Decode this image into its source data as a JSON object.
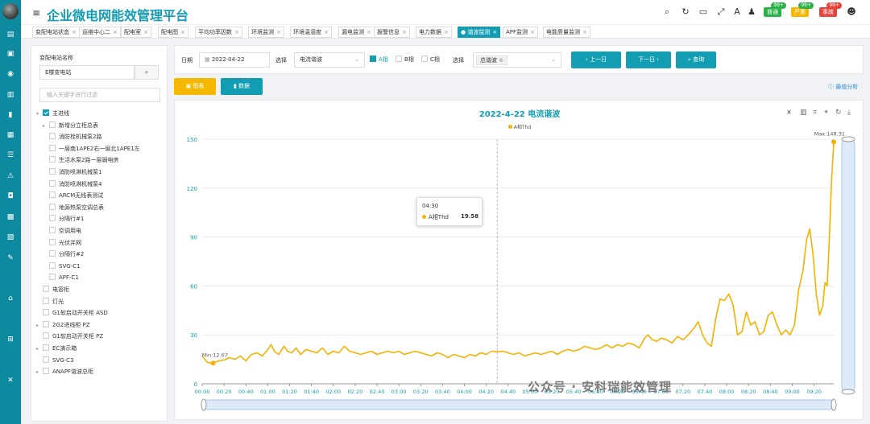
{
  "header": {
    "title": "企业微电网能效管理平台",
    "badges": [
      {
        "label": "普通",
        "count": "99+",
        "color": "#2cb24a",
        "badge_color": "#2cb24a"
      },
      {
        "label": "严重",
        "count": "99+",
        "color": "#f5b800",
        "badge_color": "#2cb24a"
      },
      {
        "label": "事故",
        "count": "99+",
        "color": "#e8463c",
        "badge_color": "#e8463c"
      }
    ]
  },
  "tabs": [
    {
      "label": "变配电站状态"
    },
    {
      "label": "运维中心二"
    },
    {
      "label": "配电室"
    },
    {
      "label": "配电图"
    },
    {
      "label": "平均功率因数"
    },
    {
      "label": "环境监测"
    },
    {
      "label": "环境温湿度"
    },
    {
      "label": "漏电监测"
    },
    {
      "label": "报警信息"
    },
    {
      "label": "电力数据"
    },
    {
      "label": "谐波监测"
    },
    {
      "label": "APF监测"
    },
    {
      "label": "电能质量监测"
    }
  ],
  "active_tab": 10,
  "left_panel": {
    "station_label": "变配电站名称",
    "station_value": "E楼变电站",
    "filter_placeholder": "输入关键字进行过滤",
    "tree": [
      {
        "label": "主进线",
        "level": 0,
        "checked": true,
        "arrow": "▾"
      },
      {
        "label": "新增分立柜总表",
        "level": 1,
        "checked": false,
        "arrow": "▸"
      },
      {
        "label": "消防栓机械泵2路",
        "level": 1,
        "checked": false,
        "arrow": ""
      },
      {
        "label": "一层南1APE2右一层北1APE1左",
        "level": 1,
        "checked": false,
        "arrow": ""
      },
      {
        "label": "生活水泵2路一层弱电房",
        "level": 1,
        "checked": false,
        "arrow": ""
      },
      {
        "label": "消防喷淋机械泵1",
        "level": 1,
        "checked": false,
        "arrow": ""
      },
      {
        "label": "消防喷淋机械泵4",
        "level": 1,
        "checked": false,
        "arrow": ""
      },
      {
        "label": "ARCM无线表测试",
        "level": 1,
        "checked": false,
        "arrow": ""
      },
      {
        "label": "地源热泵空调总表",
        "level": 1,
        "checked": false,
        "arrow": ""
      },
      {
        "label": "分隔行#1",
        "level": 1,
        "checked": false,
        "arrow": ""
      },
      {
        "label": "空调用电",
        "level": 1,
        "checked": false,
        "arrow": ""
      },
      {
        "label": "光伏并网",
        "level": 1,
        "checked": false,
        "arrow": ""
      },
      {
        "label": "分隔行#2",
        "level": 1,
        "checked": false,
        "arrow": ""
      },
      {
        "label": "SVG-C1",
        "level": 1,
        "checked": false,
        "arrow": ""
      },
      {
        "label": "APF-C1",
        "level": 1,
        "checked": false,
        "arrow": ""
      },
      {
        "label": "电容柜",
        "level": 0,
        "checked": false,
        "arrow": ""
      },
      {
        "label": "灯光",
        "level": 0,
        "checked": false,
        "arrow": ""
      },
      {
        "label": "G1软启动开关柜 ASD",
        "level": 0,
        "checked": false,
        "arrow": ""
      },
      {
        "label": "2G2进线柜 PZ",
        "level": 0,
        "checked": false,
        "arrow": "▸"
      },
      {
        "label": "G1软启动开关柜 PZ",
        "level": 0,
        "checked": false,
        "arrow": ""
      },
      {
        "label": "EC演示箱",
        "level": 0,
        "checked": false,
        "arrow": "▸"
      },
      {
        "label": "SVG-C3",
        "level": 0,
        "checked": false,
        "arrow": ""
      },
      {
        "label": "ANAPF谐波总柜",
        "level": 0,
        "checked": false,
        "arrow": "▸"
      }
    ]
  },
  "filters": {
    "date_label": "日期",
    "date_value": "2022-04-22",
    "select_label": "选择",
    "type_value": "电流谐波",
    "phase_a": "A相",
    "phase_b": "B相",
    "phase_c": "C相",
    "select_label2": "选择",
    "harmonic_chip": "总谐波",
    "prev_day": "上一日",
    "next_day": "下一日",
    "query": "查询"
  },
  "view_buttons": {
    "chart": "图表",
    "data": "数据"
  },
  "best_analysis": "最值分析",
  "chart_data": {
    "type": "line",
    "title": "2022-4-22  电流谐波",
    "series_name": "A相Thd",
    "ylim": [
      0,
      150
    ],
    "y_ticks": [
      0,
      30,
      60,
      90,
      120,
      150
    ],
    "x_ticks": [
      "00:00",
      "00:20",
      "00:40",
      "01:00",
      "01:20",
      "01:40",
      "02:00",
      "02:20",
      "02:40",
      "03:00",
      "03:20",
      "03:40",
      "04:00",
      "04:20",
      "04:40",
      "05:00",
      "05:20",
      "05:40",
      "06:00",
      "06:20",
      "06:40",
      "07:00",
      "07:20",
      "07:40",
      "08:00",
      "08:20",
      "08:40",
      "09:00",
      "09:20"
    ],
    "x_start_min": 0,
    "x_end_min": 578,
    "values": [
      [
        0,
        17
      ],
      [
        5,
        13
      ],
      [
        10,
        12.67
      ],
      [
        15,
        14
      ],
      [
        20,
        14.5
      ],
      [
        25,
        16
      ],
      [
        30,
        15
      ],
      [
        35,
        17
      ],
      [
        40,
        14
      ],
      [
        45,
        18
      ],
      [
        50,
        19
      ],
      [
        55,
        17
      ],
      [
        60,
        21
      ],
      [
        63,
        24
      ],
      [
        66,
        20
      ],
      [
        70,
        18
      ],
      [
        75,
        23
      ],
      [
        78,
        20
      ],
      [
        82,
        19
      ],
      [
        86,
        22
      ],
      [
        90,
        18
      ],
      [
        95,
        21
      ],
      [
        100,
        20
      ],
      [
        105,
        19
      ],
      [
        110,
        22
      ],
      [
        115,
        18
      ],
      [
        120,
        20
      ],
      [
        125,
        19
      ],
      [
        130,
        23
      ],
      [
        135,
        20
      ],
      [
        140,
        19
      ],
      [
        145,
        18
      ],
      [
        150,
        19
      ],
      [
        155,
        20
      ],
      [
        160,
        18
      ],
      [
        165,
        19
      ],
      [
        170,
        20
      ],
      [
        175,
        19
      ],
      [
        180,
        20
      ],
      [
        185,
        18
      ],
      [
        190,
        19
      ],
      [
        195,
        20
      ],
      [
        200,
        19
      ],
      [
        205,
        18
      ],
      [
        210,
        17
      ],
      [
        215,
        19
      ],
      [
        220,
        18
      ],
      [
        225,
        16
      ],
      [
        230,
        18
      ],
      [
        235,
        17
      ],
      [
        240,
        16
      ],
      [
        245,
        18
      ],
      [
        250,
        17
      ],
      [
        255,
        19
      ],
      [
        260,
        18
      ],
      [
        265,
        20
      ],
      [
        270,
        19.58
      ],
      [
        275,
        20
      ],
      [
        280,
        19
      ],
      [
        285,
        18
      ],
      [
        290,
        19
      ],
      [
        295,
        17
      ],
      [
        300,
        18
      ],
      [
        305,
        19
      ],
      [
        310,
        18
      ],
      [
        315,
        19
      ],
      [
        320,
        20
      ],
      [
        325,
        18
      ],
      [
        330,
        20
      ],
      [
        335,
        21
      ],
      [
        340,
        20
      ],
      [
        345,
        21
      ],
      [
        350,
        23
      ],
      [
        355,
        22
      ],
      [
        360,
        21
      ],
      [
        365,
        22
      ],
      [
        370,
        24
      ],
      [
        375,
        22
      ],
      [
        380,
        24
      ],
      [
        385,
        23
      ],
      [
        390,
        25
      ],
      [
        395,
        24
      ],
      [
        400,
        22
      ],
      [
        405,
        28
      ],
      [
        408,
        30
      ],
      [
        412,
        27
      ],
      [
        416,
        26
      ],
      [
        420,
        28
      ],
      [
        425,
        27
      ],
      [
        430,
        25
      ],
      [
        435,
        29
      ],
      [
        440,
        27
      ],
      [
        445,
        30
      ],
      [
        450,
        34
      ],
      [
        454,
        38
      ],
      [
        458,
        30
      ],
      [
        462,
        25
      ],
      [
        466,
        23
      ],
      [
        470,
        40
      ],
      [
        474,
        52
      ],
      [
        478,
        51
      ],
      [
        482,
        55
      ],
      [
        486,
        48
      ],
      [
        490,
        30
      ],
      [
        494,
        32
      ],
      [
        498,
        44
      ],
      [
        502,
        36
      ],
      [
        506,
        38
      ],
      [
        510,
        30
      ],
      [
        514,
        32
      ],
      [
        518,
        42
      ],
      [
        522,
        44
      ],
      [
        526,
        36
      ],
      [
        530,
        30
      ],
      [
        534,
        33
      ],
      [
        538,
        30
      ],
      [
        542,
        36
      ],
      [
        546,
        58
      ],
      [
        550,
        70
      ],
      [
        553,
        88
      ],
      [
        556,
        95
      ],
      [
        559,
        80
      ],
      [
        562,
        55
      ],
      [
        565,
        42
      ],
      [
        568,
        48
      ],
      [
        570,
        62
      ],
      [
        572,
        60
      ],
      [
        574,
        90
      ],
      [
        576,
        125
      ],
      [
        578,
        148.31
      ]
    ],
    "min_label": "Min:12.67",
    "max_label": "Max:148.31",
    "tooltip": {
      "time": "04:30",
      "name": "A相Thd",
      "value": "19.58"
    }
  },
  "watermark": "公众号 · 安科瑞能效管理",
  "colors": {
    "accent": "#139db3",
    "series": "#f5b100",
    "warning": "#f5b800"
  }
}
